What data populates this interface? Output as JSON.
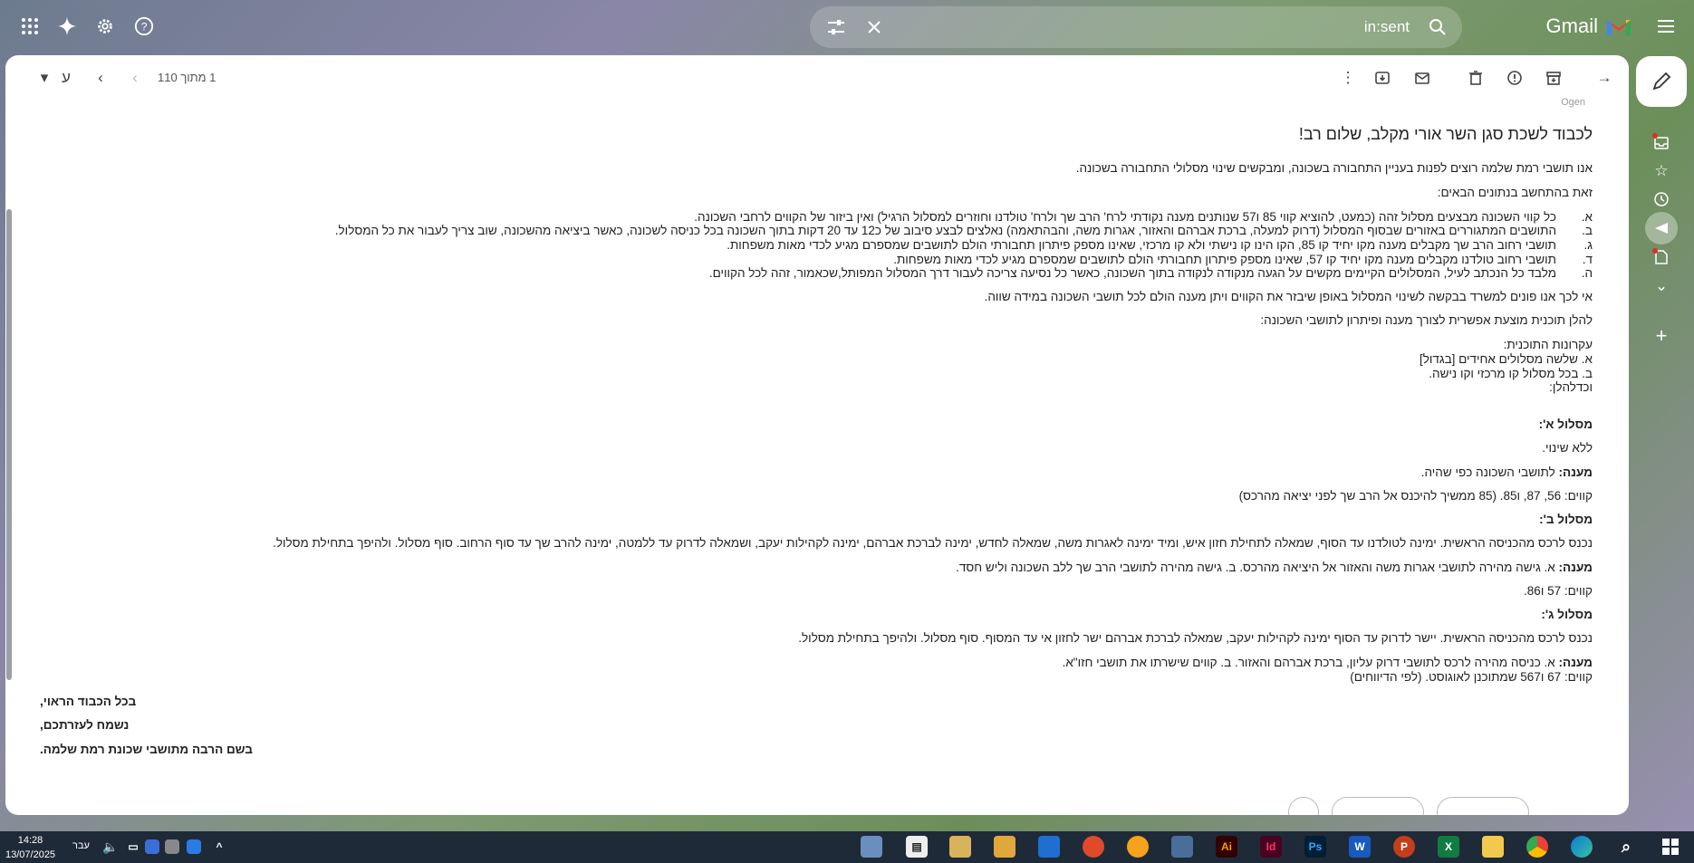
{
  "header": {
    "search_query": "in:sent",
    "brand": "Gmail"
  },
  "toolbar": {
    "pager": "1 מתוך 110",
    "lang": "ע"
  },
  "email": {
    "sender_stub": "Ogen",
    "greeting": "לכבוד לשכת סגן השר אורי מקלב, שלום רב!",
    "intro": "אנו תושבי רמת שלמה רוצים לפנות בעניין התחבורה בשכונה, ומבקשים שינוי מסלולי התחבורה בשכונה.",
    "data_intro": "זאת בהתחשב בנתונים הבאים:",
    "list": [
      {
        "mark": "א.",
        "text": "כל קווי השכונה מבצעים מסלול זהה (כמעט, להוציא קווי 85 ו57 שנותנים מענה נקודתי לרח' הרב שך ולרח' טולדנו וחוזרים למסלול הרגיל) ואין ביזור של הקווים לרחבי השכונה."
      },
      {
        "mark": "ב.",
        "text": "התושבים המתגוררים באזורים שבסוף המסלול (דרוק למעלה, ברכת אברהם והאזור, אגרות משה, והבהתאמה) נאלצים לבצע סיבוב של כ12 עד 20 דקות בתוך השכונה בכל כניסה לשכונה, כאשר ביציאה מהשכונה, שוב צריך לעבור את כל המסלול."
      },
      {
        "mark": "ג.",
        "text": "תושבי רחוב הרב שך מקבלים מענה מקו יחיד קו 85, הקו הינו קו נישתי ולא קו מרכזי, שאינו מספק פיתרון תחבורתי הולם לתושבים שמספרם מגיע לכדי מאות משפחות."
      },
      {
        "mark": "ד.",
        "text": "תושבי רחוב טולדנו מקבלים מענה מקו יחיד קו 57, שאינו מספק פיתרון תחבורתי הולם לתושבים שמספרם מגיע לכדי מאות משפחות."
      },
      {
        "mark": "ה.",
        "text": "מלבד כל הנכתב לעיל, המסלולים הקיימים מקשים על הגעה מנקודה לנקודה בתוך השכונה, כאשר כל נסיעה צריכה לעבור דרך המסלול המפותל,שכאמור, זהה לכל הקווים."
      }
    ],
    "request": "אי לכך אנו פונים למשרד בבקשה לשינוי המסלול באופן שיבזר את הקווים ויתן מענה הולם לכל תושבי השכונה במידה שווה.",
    "proposal_intro": "להלן תוכנית מוצעת אפשרית לצורך מענה ופיתרון לתושבי השכונה:",
    "principles_title": "עקרונות התוכנית:",
    "principle_a": "א. שלשה מסלולים אחידים [בגדול]",
    "principle_b": "ב. בכל מסלול קו מרכזי וקו נישה.",
    "principles_end": "וכדלהלן:",
    "route_a_title": "מסלול א':",
    "route_a_desc": "ללא שינוי.",
    "answer_label": "מענה:",
    "route_a_answer": "לתושבי השכונה כפי שהיה.",
    "route_a_lines": "קווים: 56, 87, ו85. (85 ממשיך להיכנס אל הרב שך לפני יציאה מהרכס)",
    "route_b_title": "מסלול ב':",
    "route_b_desc": "נכנס לרכס מהכניסה הראשית. ימינה לטולדנו עד הסוף, שמאלה לתחילת חזון איש, ומיד ימינה לאגרות משה, שמאלה לחדש, ימינה לברכת אברהם, ימינה לקהילות יעקב, ושמאלה לדרוק עד ללמטה, ימינה להרב שך עד סוף הרחוב. סוף מסלול. ולהיפך בתחילת מסלול.",
    "route_b_answer": "א. גישה מהירה לתושבי אגרות משה והאזור אל היציאה מהרכס. ב. גישה מהירה לתושבי הרב שך ללב השכונה וליש חסד.",
    "route_b_lines": "קווים: 57 ו86.",
    "route_c_title": "מסלול ג':",
    "route_c_desc": "נכנס לרכס מהכניסה הראשית. יישר לדרוק עד הסוף ימינה לקהילות יעקב, שמאלה לברכת אברהם ישר לחזון אי עד המסוף. סוף מסלול. ולהיפך בתחילת מסלול.",
    "route_c_answer": "א. כניסה מהירה לרכס לתושבי דרוק עליון, ברכת אברהם והאזור. ב. קווים שישרתו את תושבי חזו\"א.",
    "route_c_lines": "קווים: 67 ו567 שמתוכנן לאוגוסט. (לפי הדיווחים)",
    "closing_1": "בכל הכבוד הראוי,",
    "closing_2": "נשמח לעזרתכם,",
    "closing_3": "בשם הרבה מתושבי שכונת רמת שלמה."
  },
  "taskbar": {
    "time": "14:28",
    "date": "13/07/2025",
    "lang": "עבר"
  },
  "icons": [
    "apps-grid-icon",
    "gemini-star-icon",
    "settings-gear-icon",
    "help-icon",
    "search-options-icon",
    "clear-search-icon",
    "search-icon",
    "menu-icon",
    "compose-pencil-icon"
  ],
  "colors": {
    "gmail_red": "#ea4335",
    "accent": "#0b57d0"
  }
}
